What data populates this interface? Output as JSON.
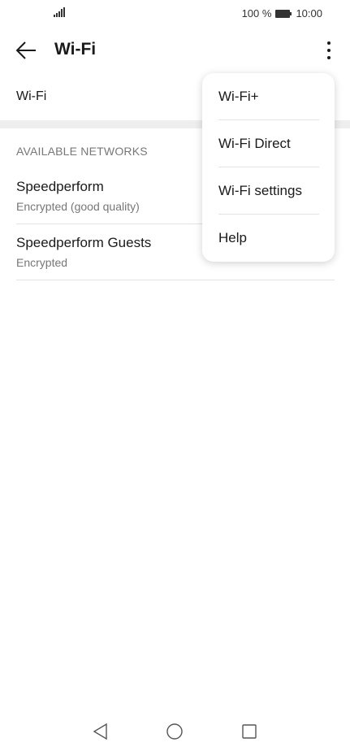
{
  "status_bar": {
    "battery_text": "100 %",
    "time": "10:00",
    "icons": [
      "signal-icon",
      "battery-icon"
    ]
  },
  "app_bar": {
    "title": "Wi-Fi",
    "icons": [
      "back-arrow-icon",
      "more-vert-icon"
    ]
  },
  "wifi_toggle": {
    "label": "Wi-Fi"
  },
  "networks_section": {
    "header": "AVAILABLE NETWORKS",
    "items": [
      {
        "name": "Speedperform",
        "status": "Encrypted (good quality)"
      },
      {
        "name": "Speedperform Guests",
        "status": "Encrypted"
      }
    ]
  },
  "overflow_menu": {
    "items": [
      {
        "label": "Wi-Fi+"
      },
      {
        "label": "Wi-Fi Direct"
      },
      {
        "label": "Wi-Fi settings"
      },
      {
        "label": "Help"
      }
    ]
  },
  "nav_bar": {
    "icons": [
      "nav-back-icon",
      "nav-home-icon",
      "nav-recents-icon"
    ]
  },
  "colors": {
    "background": "#ffffff",
    "divider_band": "#eeeeee",
    "secondary_text": "#777777",
    "primary_text": "#1a1a1a"
  }
}
